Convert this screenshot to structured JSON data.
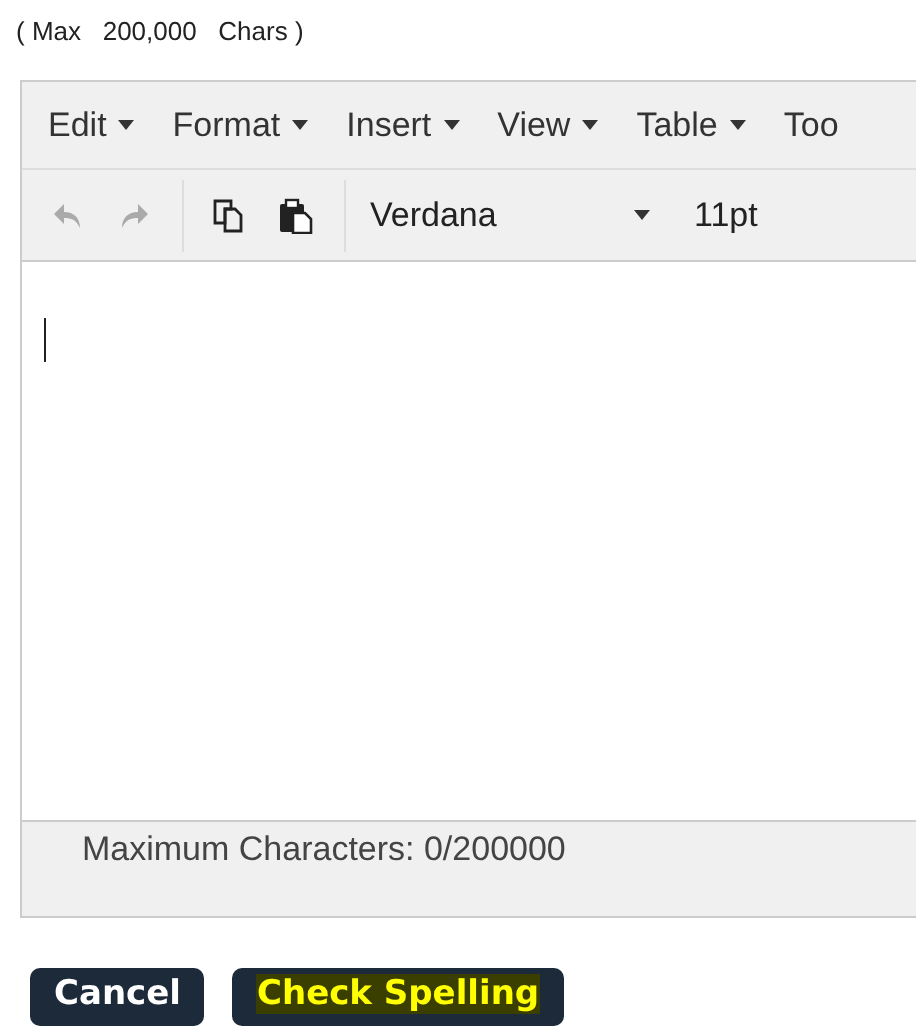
{
  "limit_note": "( Max   200,000   Chars )",
  "menus": [
    {
      "label": "Edit",
      "caret": true
    },
    {
      "label": "Format",
      "caret": true
    },
    {
      "label": "Insert",
      "caret": true
    },
    {
      "label": "View",
      "caret": true
    },
    {
      "label": "Table",
      "caret": true
    },
    {
      "label": "Too",
      "caret": false
    }
  ],
  "toolbar": [
    {
      "kind": "undo",
      "disabled": true
    },
    {
      "kind": "redo",
      "disabled": true
    },
    {
      "kind": "separator"
    },
    {
      "kind": "copy",
      "disabled": false
    },
    {
      "kind": "paste",
      "disabled": false
    },
    {
      "kind": "separator"
    },
    {
      "kind": "font",
      "value": "Verdana"
    },
    {
      "kind": "size",
      "value": "11pt"
    }
  ],
  "status_bar": "Maximum Characters: 0/200000",
  "buttons": [
    {
      "label": "Cancel",
      "highlighted": false
    },
    {
      "label": "Check Spelling",
      "highlighted": true
    }
  ]
}
